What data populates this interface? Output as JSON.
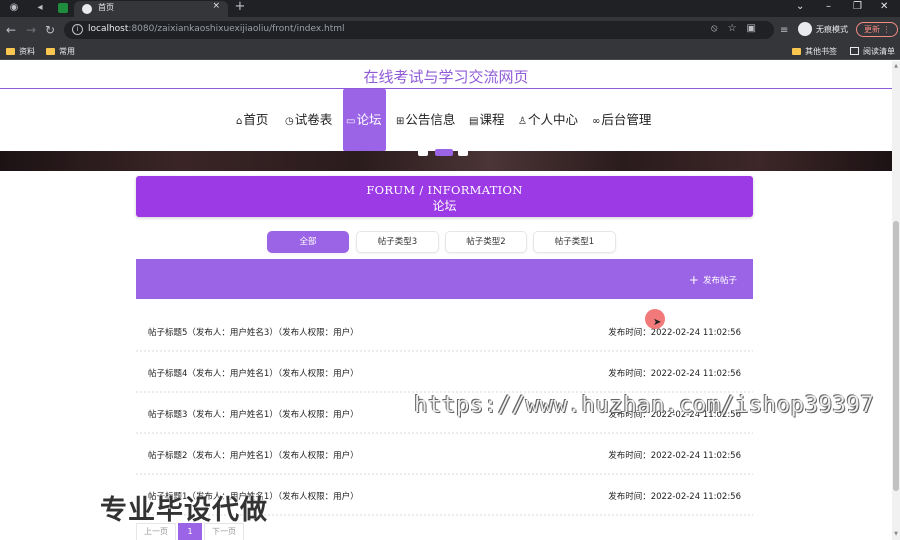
{
  "browser": {
    "tab_title": "首页",
    "url_host": "localhost",
    "url_path": ":8080/zaixiankaoshixuexijiaoliu/front/index.html",
    "incognito_label": "无痕模式",
    "update_label": "更新",
    "bookmarks": [
      "资料",
      "常用"
    ],
    "bookmarks_right": [
      "其他书签",
      "阅读清单"
    ]
  },
  "site": {
    "title": "在线考试与学习交流网页",
    "nav": [
      {
        "label": "首页",
        "icon": "home-icon"
      },
      {
        "label": "试卷表",
        "icon": "clock-icon"
      },
      {
        "label": "论坛",
        "icon": "chat-icon",
        "active": true
      },
      {
        "label": "公告信息",
        "icon": "grid-icon"
      },
      {
        "label": "课程",
        "icon": "book-icon"
      },
      {
        "label": "个人中心",
        "icon": "user-icon"
      },
      {
        "label": "后台管理",
        "icon": "link-icon"
      }
    ]
  },
  "forum": {
    "heading_en": "FORUM / INFORMATION",
    "heading_cn": "论坛",
    "filters": [
      {
        "label": "全部",
        "active": true
      },
      {
        "label": "帖子类型3"
      },
      {
        "label": "帖子类型2"
      },
      {
        "label": "帖子类型1"
      }
    ],
    "post_button": "发布帖子",
    "posts": [
      {
        "title": "帖子标题5（发布人：用户姓名3）（发布人权限：用户）",
        "time": "发布时间：2022-02-24 11:02:56"
      },
      {
        "title": "帖子标题4（发布人：用户姓名1）（发布人权限：用户）",
        "time": "发布时间：2022-02-24 11:02:56"
      },
      {
        "title": "帖子标题3（发布人：用户姓名1）（发布人权限：用户）",
        "time": "发布时间：2022-02-24 11:02:56"
      },
      {
        "title": "帖子标题2（发布人：用户姓名1）（发布人权限：用户）",
        "time": "发布时间：2022-02-24 11:02:56"
      },
      {
        "title": "帖子标题1（发布人：用户姓名1）（发布人权限：用户）",
        "time": "发布时间：2022-02-24 11:02:56"
      }
    ],
    "pager": {
      "prev": "上一页",
      "current": "1",
      "next": "下一页"
    }
  },
  "watermarks": {
    "url": "https://www.huzhan.com/ishop39397",
    "slogan": "专业毕设代做"
  },
  "colors": {
    "accent": "#9b64e6",
    "header": "#9c3be6",
    "title": "#8f5bd8"
  }
}
